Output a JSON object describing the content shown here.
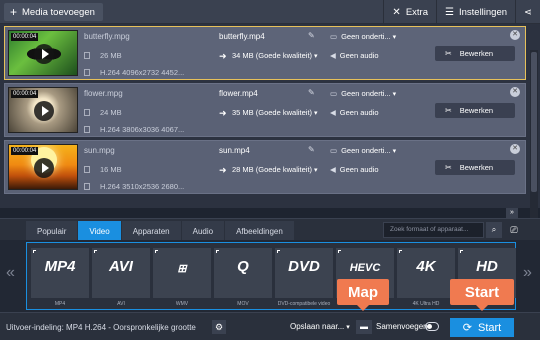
{
  "topbar": {
    "add_media": "Media toevoegen",
    "extra": "Extra",
    "settings": "Instellingen"
  },
  "files": [
    {
      "timecode": "00:00:04",
      "source_name": "butterfly.mpg",
      "source_size": "26 MB",
      "source_info": "H.264 4096x2732 4452...",
      "output_name": "butterfly.mp4",
      "output_size": "34 MB (Goede kwaliteit)",
      "subtitles": "Geen onderti...",
      "audio": "Geen audio",
      "edit": "Bewerken",
      "selected": true
    },
    {
      "timecode": "00:00:04",
      "source_name": "flower.mpg",
      "source_size": "24 MB",
      "source_info": "H.264 3806x3036 4067...",
      "output_name": "flower.mp4",
      "output_size": "35 MB (Goede kwaliteit)",
      "subtitles": "Geen onderti...",
      "audio": "Geen audio",
      "edit": "Bewerken",
      "selected": false
    },
    {
      "timecode": "00:00:04",
      "source_name": "sun.mpg",
      "source_size": "16 MB",
      "source_info": "H.264 3510x2536 2680...",
      "output_name": "sun.mp4",
      "output_size": "28 MB (Goede kwaliteit)",
      "subtitles": "Geen onderti...",
      "audio": "Geen audio",
      "edit": "Bewerken",
      "selected": false
    }
  ],
  "format_tabs": [
    "Populair",
    "Video",
    "Apparaten",
    "Audio",
    "Afbeeldingen"
  ],
  "active_tab": "Video",
  "search_placeholder": "Zoek formaat of apparaat...",
  "formats": [
    {
      "logo": "MP4",
      "label": "MP4"
    },
    {
      "logo": "AVI",
      "label": "AVI"
    },
    {
      "logo": "WMV",
      "label": "WMV"
    },
    {
      "logo": "Q",
      "label": "MOV"
    },
    {
      "logo": "DVD",
      "label": "DVD-compatibele video"
    },
    {
      "logo": "HEVC",
      "label": ""
    },
    {
      "logo": "4K",
      "label": "4K Ultra HD"
    },
    {
      "logo": "HD",
      "label": ""
    }
  ],
  "bottombar": {
    "output_format": "Uitvoer-indeling: MP4 H.264 - Oorspronkelijke grootte",
    "save_to": "Opslaan naar...",
    "merge": "Samenvoegen",
    "start": "Start"
  },
  "callouts": {
    "map": "Map",
    "start": "Start"
  },
  "colors": {
    "accent": "#1a8fe0",
    "callout": "#f07a50",
    "selected_border": "#e7c15a"
  }
}
